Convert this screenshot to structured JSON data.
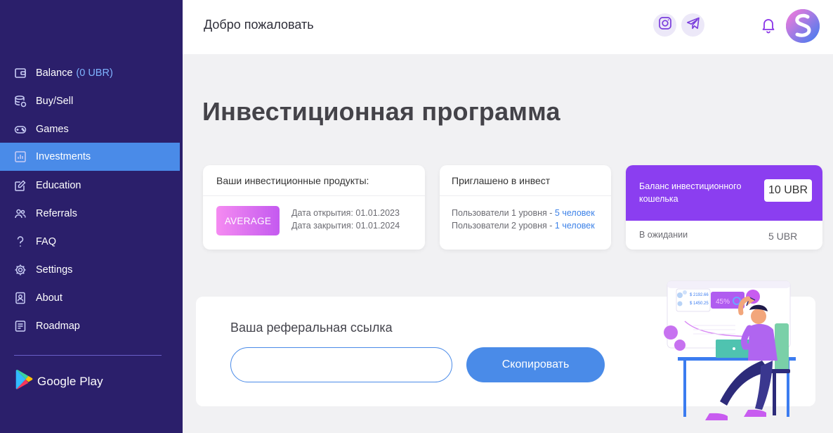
{
  "sidebar": {
    "items": [
      {
        "label": "Balance",
        "extra": "(0 UBR)"
      },
      {
        "label": "Buy/Sell"
      },
      {
        "label": "Games"
      },
      {
        "label": "Investments"
      },
      {
        "label": "Education"
      },
      {
        "label": "Referrals"
      },
      {
        "label": "FAQ"
      },
      {
        "label": "Settings"
      },
      {
        "label": "About"
      },
      {
        "label": "Roadmap"
      }
    ],
    "store_label": "Google Play"
  },
  "header": {
    "welcome": "Добро пожаловать"
  },
  "main": {
    "title": "Инвестиционная программа",
    "products_card": {
      "title": "Ваши инвестиционные продукты:",
      "product_name": "AVERAGE",
      "open_date": "Дата открытия: 01.01.2023",
      "close_date": "Дата закрытия: 01.01.2024"
    },
    "invited_card": {
      "title": "Приглашено в инвест",
      "level1_label": "Пользователи 1 уровня - ",
      "level1_value": "5 человек",
      "level2_label": "Пользователи 2 уровня - ",
      "level2_value": "1 человек"
    },
    "wallet_card": {
      "label": "Баланс инвестиционного кошелька",
      "amount": "10 UBR",
      "pending_label": "В ожидании",
      "pending_amount": "5 UBR"
    },
    "referral": {
      "title": "Ваша реферальная ссылка",
      "input_value": "",
      "button_label": "Скопировать"
    },
    "illustration": {
      "stat1": "$ 2192.66",
      "stat2": "$ 1450.25",
      "percent": "45%"
    }
  },
  "colors": {
    "sidebar_bg": "#2b1f6b",
    "active_item": "#4a8be8",
    "wallet_purple": "#8b3ef0",
    "accent_blue": "#3d82e8"
  }
}
